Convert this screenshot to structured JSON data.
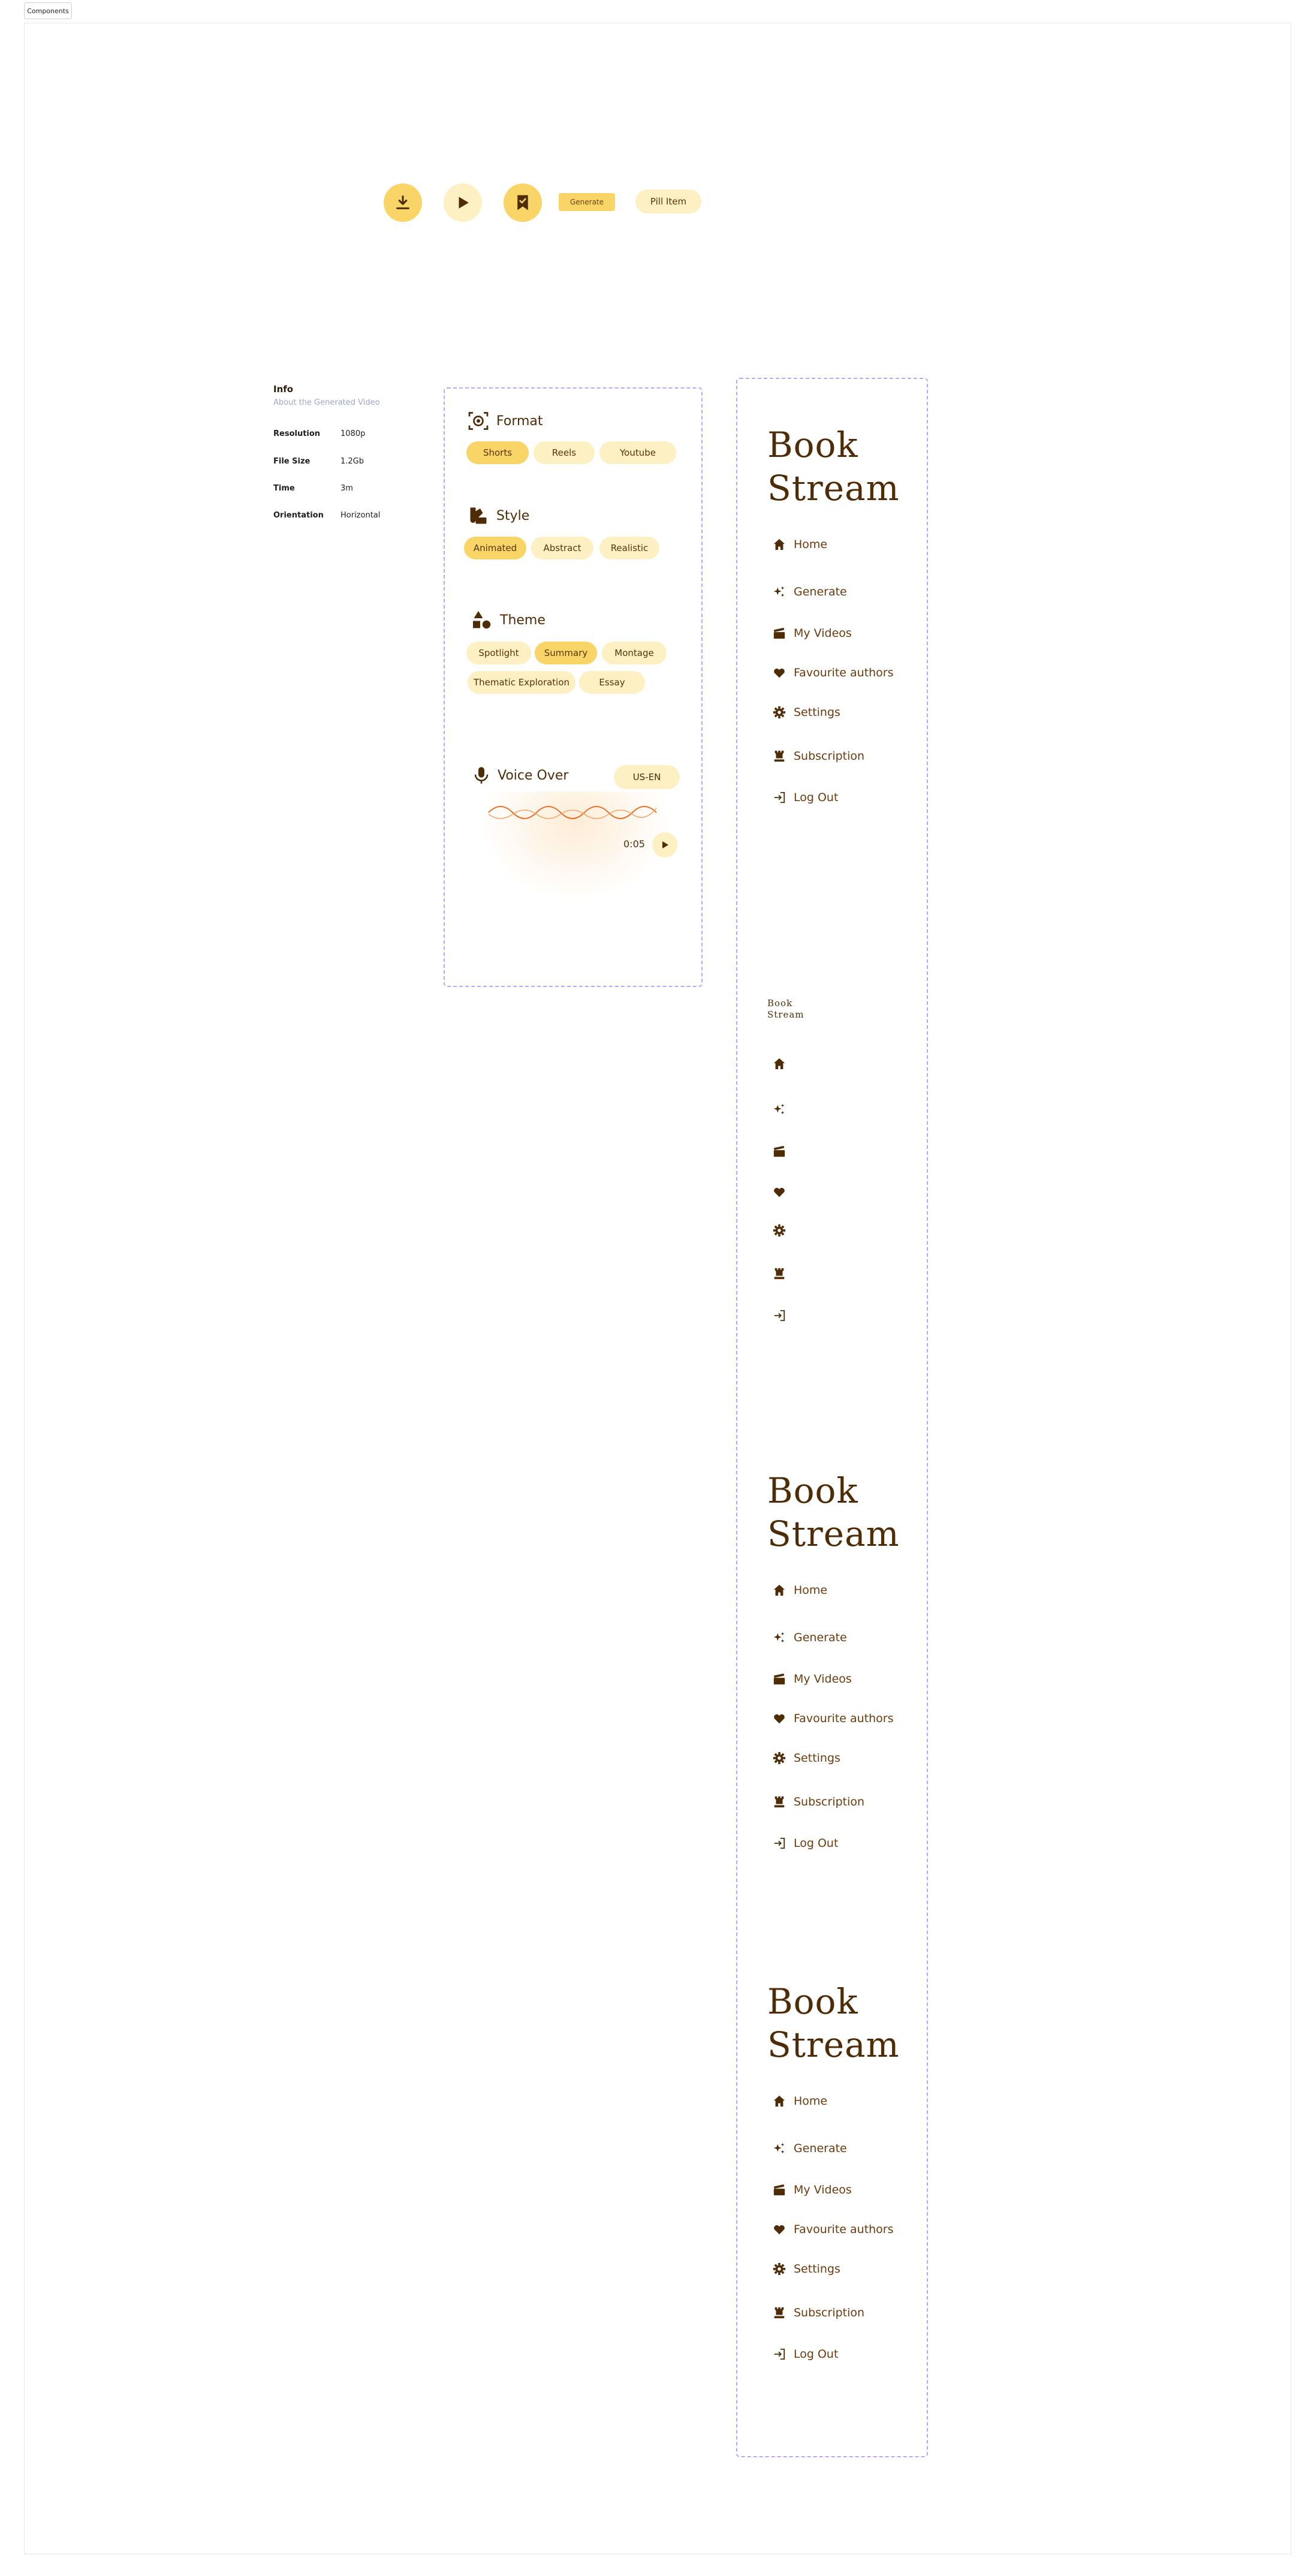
{
  "page": {
    "tab_label": "Components"
  },
  "buttons": {
    "generate_label": "Generate",
    "pill_label": "Pill Item"
  },
  "info": {
    "title": "Info",
    "subtitle": "About the Generated Video",
    "rows": [
      {
        "label": "Resolution",
        "value": "1080p"
      },
      {
        "label": "File Size",
        "value": "1.2Gb"
      },
      {
        "label": "Time",
        "value": "3m"
      },
      {
        "label": "Orientation",
        "value": "Horizontal"
      }
    ]
  },
  "options": {
    "format": {
      "title": "Format",
      "chips": [
        "Shorts",
        "Reels",
        "Youtube"
      ],
      "selected": "Shorts"
    },
    "style": {
      "title": "Style",
      "chips": [
        "Animated",
        "Abstract",
        "Realistic"
      ],
      "selected": "Animated"
    },
    "theme": {
      "title": "Theme",
      "chips": [
        "Spotlight",
        "Summary",
        "Montage",
        "Thematic Exploration",
        "Essay"
      ],
      "selected": "Summary"
    },
    "voice": {
      "title": "Voice Over",
      "locale": "US-EN",
      "time": "0:05"
    }
  },
  "sidebar": {
    "brand_line1": "Book",
    "brand_line2": "Stream",
    "items": [
      {
        "label": "Home",
        "icon": "home-icon"
      },
      {
        "label": "Generate",
        "icon": "sparkle-icon"
      },
      {
        "label": "My Videos",
        "icon": "clapperboard-icon"
      },
      {
        "label": "Favourite authors",
        "icon": "heart-icon"
      },
      {
        "label": "Settings",
        "icon": "gear-icon"
      },
      {
        "label": "Subscription",
        "icon": "crown-icon"
      },
      {
        "label": "Log Out",
        "icon": "logout-icon"
      }
    ]
  },
  "colors": {
    "accent": "#f9d466",
    "accent_light": "#fdf0c2",
    "text_brown": "#5a3307",
    "dashed_border": "#b9a7f5",
    "wave": "#e8722a"
  }
}
